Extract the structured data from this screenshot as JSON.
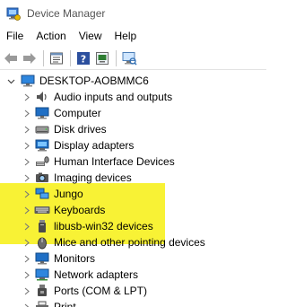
{
  "window": {
    "title": "Device Manager"
  },
  "menu": [
    "File",
    "Action",
    "View",
    "Help"
  ],
  "toolbar": [
    {
      "icon": "back-arrow-icon"
    },
    {
      "icon": "forward-arrow-icon"
    },
    {
      "icon": "properties-icon"
    },
    {
      "icon": "help-icon"
    },
    {
      "icon": "update-driver-icon"
    },
    {
      "icon": "scan-hardware-icon"
    }
  ],
  "tree": {
    "root": "DESKTOP-AOBMMC6",
    "items": [
      {
        "label": "Audio inputs and outputs",
        "icon": "speaker-icon"
      },
      {
        "label": "Computer",
        "icon": "computer-icon"
      },
      {
        "label": "Disk drives",
        "icon": "disk-drive-icon"
      },
      {
        "label": "Display adapters",
        "icon": "display-adapter-icon"
      },
      {
        "label": "Human Interface Devices",
        "icon": "hid-icon"
      },
      {
        "label": "Imaging devices",
        "icon": "camera-icon"
      },
      {
        "label": "Jungo",
        "icon": "network-icon"
      },
      {
        "label": "Keyboards",
        "icon": "keyboard-icon"
      },
      {
        "label": "libusb-win32 devices",
        "icon": "usb-device-icon"
      },
      {
        "label": "Mice and other pointing devices",
        "icon": "mouse-icon"
      },
      {
        "label": "Monitors",
        "icon": "monitor-icon"
      },
      {
        "label": "Network adapters",
        "icon": "network-adapter-icon"
      },
      {
        "label": "Ports (COM & LPT)",
        "icon": "port-icon"
      },
      {
        "label": "Print...",
        "icon": "printer-icon"
      }
    ]
  },
  "colors": {
    "highlight": "#f7f012",
    "accent": "#1f6fc5"
  }
}
